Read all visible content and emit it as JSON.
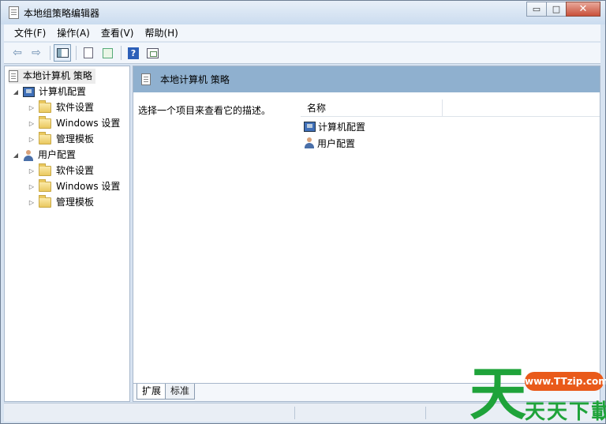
{
  "window": {
    "title": "本地组策略编辑器",
    "controls": {
      "minimize": "▭",
      "maximize": "□",
      "close": "✕"
    }
  },
  "menu": [
    "文件(F)",
    "操作(A)",
    "查看(V)",
    "帮助(H)"
  ],
  "toolbar": {
    "icons": [
      "back-arrow-icon",
      "forward-arrow-icon",
      "show-hide-tree-icon",
      "properties-icon",
      "export-list-icon",
      "help-icon",
      "show-action-pane-icon"
    ],
    "back": "⇦",
    "forward": "⇨",
    "help": "?"
  },
  "tree": {
    "root": "本地计算机 策略",
    "nodes": [
      {
        "label": "计算机配置",
        "expanded": true,
        "icon": "computer-icon",
        "children": [
          "软件设置",
          "Windows 设置",
          "管理模板"
        ]
      },
      {
        "label": "用户配置",
        "expanded": true,
        "icon": "user-icon",
        "children": [
          "软件设置",
          "Windows 设置",
          "管理模板"
        ]
      }
    ],
    "expander_open": "◢",
    "expander_closed": "▷"
  },
  "right": {
    "header_title": "本地计算机 策略",
    "description": "选择一个项目来查看它的描述。",
    "column_name": "名称",
    "items": [
      "计算机配置",
      "用户配置"
    ],
    "tabs": [
      "扩展",
      "标准"
    ]
  },
  "watermark": {
    "char": "天",
    "badge": "www.TTzip.com",
    "text": "天天下載"
  },
  "colors": {
    "header_blue": "#8fb0cf",
    "watermark_green": "#1fa33a",
    "watermark_orange": "#e95a1a"
  }
}
